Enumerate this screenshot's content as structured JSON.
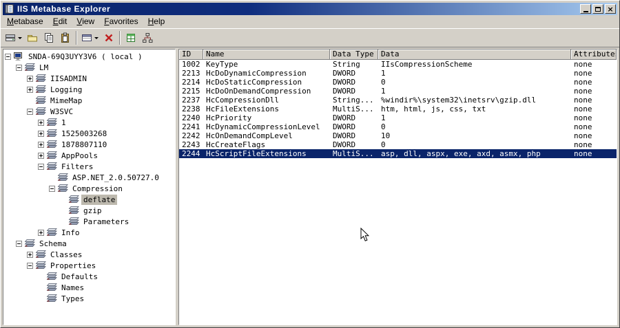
{
  "colors": {
    "chrome": "#d4d0c8",
    "selection": "#0a246a",
    "titlebar_start": "#0a246a",
    "titlebar_end": "#a6caf0"
  },
  "window": {
    "title": "IIS Metabase Explorer",
    "controls": [
      {
        "name": "minimize-button",
        "glyph": "minimize"
      },
      {
        "name": "maximize-button",
        "glyph": "maximize"
      },
      {
        "name": "close-button",
        "glyph": "close"
      }
    ]
  },
  "menu": {
    "items": [
      "Metabase",
      "Edit",
      "View",
      "Favorites",
      "Help"
    ]
  },
  "toolbar": {
    "buttons": [
      {
        "name": "new-key-button",
        "icon": "drive-icon",
        "caret": true
      },
      {
        "name": "open-button",
        "icon": "folder-icon"
      },
      {
        "name": "copy-button",
        "icon": "copy-icon"
      },
      {
        "name": "paste-button",
        "icon": "paste-icon"
      },
      {
        "separator": true
      },
      {
        "name": "new-data-button",
        "icon": "record-icon",
        "caret": true
      },
      {
        "name": "delete-button",
        "icon": "delete-x-icon"
      },
      {
        "separator": true
      },
      {
        "name": "refresh-button",
        "icon": "grid-green-icon"
      },
      {
        "name": "connect-button",
        "icon": "network-icon"
      }
    ]
  },
  "tree": {
    "rows": [
      {
        "label": "SNDA-69Q3UYY3V6 ( local )",
        "level": 0,
        "expander": "minus",
        "icon": "computer-icon"
      },
      {
        "label": "LM",
        "level": 1,
        "expander": "minus",
        "icon": "key-icon"
      },
      {
        "label": "IISADMIN",
        "level": 2,
        "expander": "plus",
        "icon": "key-icon"
      },
      {
        "label": "Logging",
        "level": 2,
        "expander": "plus",
        "icon": "key-icon"
      },
      {
        "label": "MimeMap",
        "level": 2,
        "expander": "",
        "icon": "key-icon"
      },
      {
        "label": "W3SVC",
        "level": 2,
        "expander": "minus",
        "icon": "key-icon"
      },
      {
        "label": "1",
        "level": 3,
        "expander": "plus",
        "icon": "key-icon"
      },
      {
        "label": "1525003268",
        "level": 3,
        "expander": "plus",
        "icon": "key-icon"
      },
      {
        "label": "1878807110",
        "level": 3,
        "expander": "plus",
        "icon": "key-icon"
      },
      {
        "label": "AppPools",
        "level": 3,
        "expander": "plus",
        "icon": "key-icon"
      },
      {
        "label": "Filters",
        "level": 3,
        "expander": "minus",
        "icon": "key-icon"
      },
      {
        "label": "ASP.NET_2.0.50727.0",
        "level": 4,
        "expander": "",
        "icon": "key-icon"
      },
      {
        "label": "Compression",
        "level": 4,
        "expander": "minus",
        "icon": "key-icon"
      },
      {
        "label": "deflate",
        "level": 5,
        "expander": "",
        "icon": "key-icon",
        "selected": true
      },
      {
        "label": "gzip",
        "level": 5,
        "expander": "",
        "icon": "key-icon"
      },
      {
        "label": "Parameters",
        "level": 5,
        "expander": "",
        "icon": "key-icon"
      },
      {
        "label": "Info",
        "level": 3,
        "expander": "plus",
        "icon": "key-icon"
      },
      {
        "label": "Schema",
        "level": 1,
        "expander": "minus",
        "icon": "key-icon"
      },
      {
        "label": "Classes",
        "level": 2,
        "expander": "plus",
        "icon": "key-icon"
      },
      {
        "label": "Properties",
        "level": 2,
        "expander": "minus",
        "icon": "key-icon"
      },
      {
        "label": "Defaults",
        "level": 3,
        "expander": "",
        "icon": "key-icon"
      },
      {
        "label": "Names",
        "level": 3,
        "expander": "",
        "icon": "key-icon"
      },
      {
        "label": "Types",
        "level": 3,
        "expander": "",
        "icon": "key-icon"
      }
    ]
  },
  "table": {
    "columns": [
      "ID",
      "Name",
      "Data Type",
      "Data",
      "Attributes"
    ],
    "selected_id": "2244",
    "rows": [
      [
        "1002",
        "KeyType",
        "String",
        "IIsCompressionScheme",
        "none"
      ],
      [
        "2213",
        "HcDoDynamicCompression",
        "DWORD",
        "1",
        "none"
      ],
      [
        "2214",
        "HcDoStaticCompression",
        "DWORD",
        "0",
        "none"
      ],
      [
        "2215",
        "HcDoOnDemandCompression",
        "DWORD",
        "1",
        "none"
      ],
      [
        "2237",
        "HcCompressionDll",
        "String...",
        "%windir%\\system32\\inetsrv\\gzip.dll",
        "none"
      ],
      [
        "2238",
        "HcFileExtensions",
        "MultiS...",
        "htm, html, js, css, txt",
        "none"
      ],
      [
        "2240",
        "HcPriority",
        "DWORD",
        "1",
        "none"
      ],
      [
        "2241",
        "HcDynamicCompressionLevel",
        "DWORD",
        "0",
        "none"
      ],
      [
        "2242",
        "HcOnDemandCompLevel",
        "DWORD",
        "10",
        "none"
      ],
      [
        "2243",
        "HcCreateFlags",
        "DWORD",
        "0",
        "none"
      ],
      [
        "2244",
        "HcScriptFileExtensions",
        "MultiS...",
        "asp, dll, aspx, exe, axd, asmx, php",
        "none"
      ]
    ]
  }
}
